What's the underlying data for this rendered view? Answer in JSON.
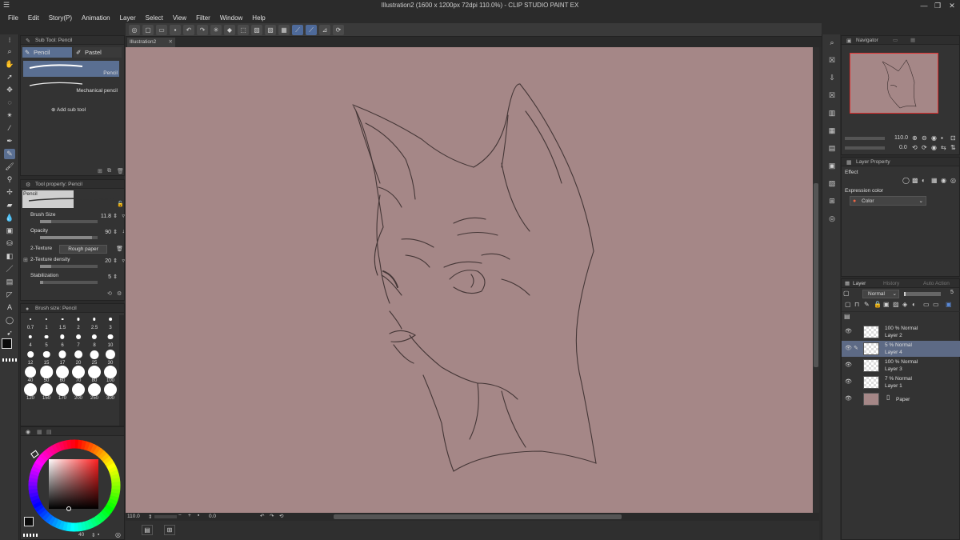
{
  "window": {
    "title": "Illustration2 (1600 x 1200px 72dpi 110.0%) - CLIP STUDIO PAINT EX"
  },
  "menu": [
    "File",
    "Edit",
    "Story(P)",
    "Animation",
    "Layer",
    "Select",
    "View",
    "Filter",
    "Window",
    "Help"
  ],
  "canvas_tab": {
    "label": "Illustration2"
  },
  "subtool": {
    "title": "Sub Tool: Pencil",
    "tabs": [
      "Pencil",
      "Pastel"
    ],
    "brushes": [
      "Pencil",
      "Mechanical pencil"
    ],
    "add_label": "Add sub tool"
  },
  "tool_property": {
    "title": "Tool property: Pencil",
    "preview_label": "Pencil",
    "brush_size_label": "Brush Size",
    "brush_size_value": "11.8",
    "opacity_label": "Opacity",
    "opacity_value": "90",
    "texture_label": "2-Texture",
    "texture_value": "Rough paper",
    "texture_density_label": "2-Texture density",
    "texture_density_value": "20",
    "stabilization_label": "Stabilization",
    "stabilization_value": "5"
  },
  "brush_size": {
    "title": "Brush size: Pencil",
    "sizes": [
      "0.7",
      "1",
      "1.5",
      "2",
      "2.5",
      "3",
      "4",
      "5",
      "6",
      "7",
      "8",
      "10",
      "12",
      "15",
      "17",
      "20",
      "25",
      "30",
      "40",
      "50",
      "60",
      "70",
      "80",
      "100",
      "120",
      "150",
      "170",
      "200",
      "250",
      "300"
    ]
  },
  "color": {
    "main": "#0b0b0b",
    "sub": "#ffffff",
    "picker_hue": "#ff1f1f",
    "readout": "40"
  },
  "status": {
    "zoom": "110.0",
    "rotation": "0.0"
  },
  "navigator": {
    "title": "Navigator",
    "zoom": "110.0",
    "rotation": "0.0"
  },
  "layer_property": {
    "title": "Layer Property",
    "effect_label": "Effect",
    "expression_label": "Expression color",
    "expression_value": "Color"
  },
  "layer": {
    "tabs": [
      "Layer",
      "History",
      "Auto Action"
    ],
    "blend_mode": "Normal",
    "opacity": "5",
    "layers": [
      {
        "pct": "100 % Normal",
        "name": "Layer 2",
        "selected": false
      },
      {
        "pct": "5 % Normal",
        "name": "Layer 4",
        "selected": true
      },
      {
        "pct": "100 % Normal",
        "name": "Layer 3",
        "selected": false
      },
      {
        "pct": "7 % Normal",
        "name": "Layer 1",
        "selected": false
      },
      {
        "pct": "",
        "name": "Paper",
        "selected": false
      }
    ]
  },
  "colors": {
    "canvas": "#a58787",
    "accent": "#5a6f92",
    "selection": "#5d6a85"
  }
}
